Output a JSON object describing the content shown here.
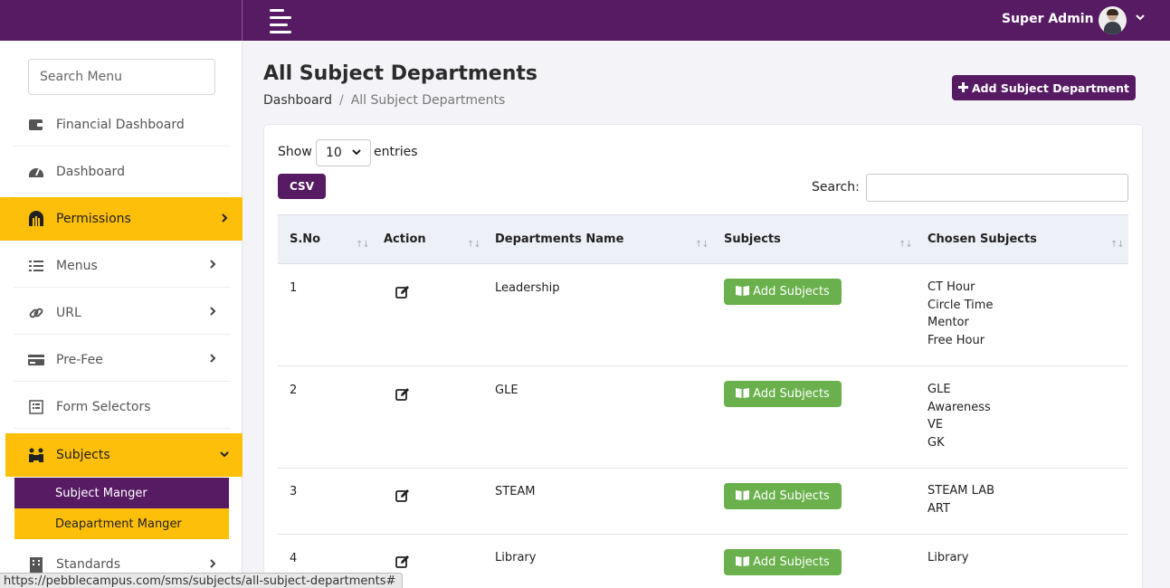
{
  "header": {
    "user_name": "Super Admin",
    "chevron": "⌄"
  },
  "sidebar": {
    "search_placeholder": "Search Menu",
    "items": [
      {
        "label": "Financial Dashboard",
        "icon": "wallet-icon"
      },
      {
        "label": "Dashboard",
        "icon": "gauge-icon"
      },
      {
        "label": "Permissions",
        "icon": "dungeon-icon",
        "chevron": "›"
      },
      {
        "label": "Menus",
        "icon": "list-icon",
        "chevron": "›"
      },
      {
        "label": "URL",
        "icon": "link-icon",
        "chevron": "›"
      },
      {
        "label": "Pre-Fee",
        "icon": "credit-card-icon",
        "chevron": "›"
      },
      {
        "label": "Form Selectors",
        "icon": "form-icon"
      },
      {
        "label": "Subjects",
        "icon": "people-carry-icon",
        "chevron": "⌄"
      },
      {
        "label": "Standards",
        "icon": "building-icon",
        "chevron": "›"
      }
    ],
    "sub_items": [
      {
        "label": "Subject Manger"
      },
      {
        "label": "Deapartment Manger"
      }
    ]
  },
  "page": {
    "title": "All Subject Departments",
    "breadcrumb_home": "Dashboard",
    "breadcrumb_sep": "/",
    "breadcrumb_current": "All Subject Departments",
    "add_button": "Add Subject Department"
  },
  "table_controls": {
    "show_label": "Show",
    "entries_value": "10",
    "entries_label": "entries",
    "csv_label": "CSV",
    "search_label": "Search:"
  },
  "table": {
    "columns": [
      "S.No",
      "Action",
      "Departments Name",
      "Subjects",
      "Chosen Subjects"
    ],
    "sort_glyph": "↑↓",
    "add_subjects_label": "Add Subjects",
    "rows": [
      {
        "sno": "1",
        "name": "Leadership",
        "chosen": [
          "CT Hour",
          "Circle Time",
          "Mentor",
          "Free Hour"
        ]
      },
      {
        "sno": "2",
        "name": "GLE",
        "chosen": [
          "GLE",
          "Awareness",
          "VE",
          "GK"
        ]
      },
      {
        "sno": "3",
        "name": "STEAM",
        "chosen": [
          "STEAM LAB",
          "ART"
        ]
      },
      {
        "sno": "4",
        "name": "Library",
        "chosen": [
          "Library"
        ]
      }
    ]
  },
  "status_bar": {
    "url": "https://pebblecampus.com/sms/subjects/all-subject-departments#"
  },
  "colors": {
    "brand_purple": "#561b63",
    "accent_yellow": "#fdbf0a",
    "button_green": "#6ab04c"
  }
}
